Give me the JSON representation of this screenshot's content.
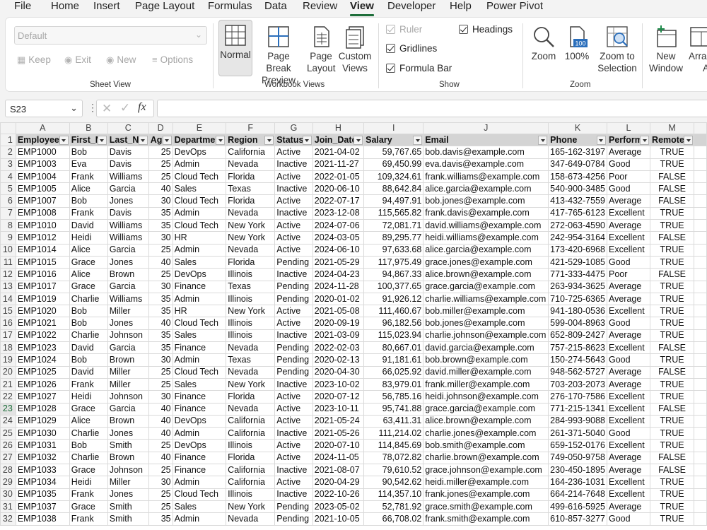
{
  "menu": {
    "tabs": [
      {
        "id": "file",
        "label": "File"
      },
      {
        "id": "home",
        "label": "Home"
      },
      {
        "id": "insert",
        "label": "Insert"
      },
      {
        "id": "page-layout",
        "label": "Page Layout"
      },
      {
        "id": "formulas",
        "label": "Formulas"
      },
      {
        "id": "data",
        "label": "Data"
      },
      {
        "id": "review",
        "label": "Review"
      },
      {
        "id": "view",
        "label": "View"
      },
      {
        "id": "developer",
        "label": "Developer"
      },
      {
        "id": "help",
        "label": "Help"
      },
      {
        "id": "power-pivot",
        "label": "Power Pivot"
      }
    ],
    "active": "View"
  },
  "ribbon": {
    "sheet_view": {
      "label": "Sheet View",
      "select_value": "Default",
      "keep": "Keep",
      "exit": "Exit",
      "new": "New",
      "options": "Options"
    },
    "workbook_views": {
      "label": "Workbook Views",
      "normal": "Normal",
      "page_break_preview_1": "Page Break",
      "page_break_preview_2": "Preview",
      "page_layout_1": "Page",
      "page_layout_2": "Layout",
      "custom_views_1": "Custom",
      "custom_views_2": "Views"
    },
    "show": {
      "label": "Show",
      "ruler": "Ruler",
      "gridlines": "Gridlines",
      "formula_bar": "Formula Bar",
      "headings": "Headings"
    },
    "zoom": {
      "label": "Zoom",
      "zoom": "Zoom",
      "hundred": "100%",
      "hundred_icon": "100",
      "zoom_sel_1": "Zoom to",
      "zoom_sel_2": "Selection"
    },
    "window": {
      "new_window_1": "New",
      "new_window_2": "Window",
      "arrange_1": "Arran",
      "arrange_2": "Al"
    }
  },
  "formula_bar": {
    "name_box": "S23",
    "fx": "fx",
    "formula": ""
  },
  "grid": {
    "columns": [
      "A",
      "B",
      "C",
      "D",
      "E",
      "F",
      "G",
      "H",
      "I",
      "J",
      "K",
      "L",
      "M"
    ],
    "header_row": [
      "Employee",
      "First_N",
      "Last_N",
      "Ag",
      "Departme",
      "Region",
      "Status",
      "Join_Date",
      "Salary",
      "Email",
      "Phone",
      "Perform",
      "Remote"
    ],
    "selected_row": 23,
    "rows": [
      [
        "EMP1000",
        "Bob",
        "Davis",
        "25",
        "DevOps",
        "California",
        "Active",
        "2021-04-02",
        "59,767.65",
        "bob.davis@example.com",
        "165-162-3197",
        "Average",
        "TRUE"
      ],
      [
        "EMP1003",
        "Eva",
        "Davis",
        "25",
        "Admin",
        "Nevada",
        "Inactive",
        "2021-11-27",
        "69,450.99",
        "eva.davis@example.com",
        "347-649-0784",
        "Good",
        "TRUE"
      ],
      [
        "EMP1004",
        "Frank",
        "Williams",
        "25",
        "Cloud Tech",
        "Florida",
        "Active",
        "2022-01-05",
        "109,324.61",
        "frank.williams@example.com",
        "158-673-4256",
        "Poor",
        "FALSE"
      ],
      [
        "EMP1005",
        "Alice",
        "Garcia",
        "40",
        "Sales",
        "Texas",
        "Inactive",
        "2020-06-10",
        "88,642.84",
        "alice.garcia@example.com",
        "540-900-3485",
        "Good",
        "FALSE"
      ],
      [
        "EMP1007",
        "Bob",
        "Jones",
        "30",
        "Cloud Tech",
        "Florida",
        "Active",
        "2022-07-17",
        "94,497.91",
        "bob.jones@example.com",
        "413-432-7559",
        "Average",
        "FALSE"
      ],
      [
        "EMP1008",
        "Frank",
        "Davis",
        "35",
        "Admin",
        "Nevada",
        "Inactive",
        "2023-12-08",
        "115,565.82",
        "frank.davis@example.com",
        "417-765-6123",
        "Excellent",
        "TRUE"
      ],
      [
        "EMP1010",
        "David",
        "Williams",
        "35",
        "Cloud Tech",
        "New York",
        "Active",
        "2024-07-06",
        "72,081.71",
        "david.williams@example.com",
        "272-063-4590",
        "Average",
        "TRUE"
      ],
      [
        "EMP1012",
        "Heidi",
        "Williams",
        "30",
        "HR",
        "New York",
        "Active",
        "2024-03-05",
        "89,295.77",
        "heidi.williams@example.com",
        "242-954-3164",
        "Excellent",
        "FALSE"
      ],
      [
        "EMP1014",
        "Alice",
        "Garcia",
        "25",
        "Admin",
        "Nevada",
        "Active",
        "2024-06-10",
        "97,633.68",
        "alice.garcia@example.com",
        "173-420-6968",
        "Excellent",
        "TRUE"
      ],
      [
        "EMP1015",
        "Grace",
        "Jones",
        "40",
        "Sales",
        "Florida",
        "Pending",
        "2021-05-29",
        "117,975.49",
        "grace.jones@example.com",
        "421-529-1085",
        "Good",
        "TRUE"
      ],
      [
        "EMP1016",
        "Alice",
        "Brown",
        "25",
        "DevOps",
        "Illinois",
        "Inactive",
        "2024-04-23",
        "94,867.33",
        "alice.brown@example.com",
        "771-333-4475",
        "Poor",
        "FALSE"
      ],
      [
        "EMP1017",
        "Grace",
        "Garcia",
        "30",
        "Finance",
        "Texas",
        "Pending",
        "2024-11-28",
        "100,377.65",
        "grace.garcia@example.com",
        "263-934-3625",
        "Average",
        "TRUE"
      ],
      [
        "EMP1019",
        "Charlie",
        "Williams",
        "35",
        "Admin",
        "Illinois",
        "Pending",
        "2020-01-02",
        "91,926.12",
        "charlie.williams@example.com",
        "710-725-6365",
        "Average",
        "TRUE"
      ],
      [
        "EMP1020",
        "Bob",
        "Miller",
        "35",
        "HR",
        "New York",
        "Active",
        "2021-05-08",
        "111,460.67",
        "bob.miller@example.com",
        "941-180-0536",
        "Excellent",
        "TRUE"
      ],
      [
        "EMP1021",
        "Bob",
        "Jones",
        "40",
        "Cloud Tech",
        "Illinois",
        "Active",
        "2020-09-19",
        "96,182.56",
        "bob.jones@example.com",
        "599-004-8963",
        "Good",
        "TRUE"
      ],
      [
        "EMP1022",
        "Charlie",
        "Johnson",
        "35",
        "Sales",
        "Illinois",
        "Inactive",
        "2021-03-09",
        "115,023.94",
        "charlie.johnson@example.com",
        "652-809-2427",
        "Average",
        "TRUE"
      ],
      [
        "EMP1023",
        "David",
        "Garcia",
        "35",
        "Finance",
        "Nevada",
        "Pending",
        "2022-02-03",
        "80,667.01",
        "david.garcia@example.com",
        "757-215-8623",
        "Excellent",
        "FALSE"
      ],
      [
        "EMP1024",
        "Bob",
        "Brown",
        "30",
        "Admin",
        "Texas",
        "Pending",
        "2020-02-13",
        "91,181.61",
        "bob.brown@example.com",
        "150-274-5643",
        "Good",
        "TRUE"
      ],
      [
        "EMP1025",
        "David",
        "Miller",
        "25",
        "Cloud Tech",
        "Nevada",
        "Pending",
        "2020-04-30",
        "66,025.92",
        "david.miller@example.com",
        "948-562-5727",
        "Average",
        "FALSE"
      ],
      [
        "EMP1026",
        "Frank",
        "Miller",
        "25",
        "Sales",
        "New York",
        "Inactive",
        "2023-10-02",
        "83,979.01",
        "frank.miller@example.com",
        "703-203-2073",
        "Average",
        "TRUE"
      ],
      [
        "EMP1027",
        "Heidi",
        "Johnson",
        "30",
        "Finance",
        "Florida",
        "Active",
        "2020-07-12",
        "56,785.16",
        "heidi.johnson@example.com",
        "276-170-7586",
        "Excellent",
        "TRUE"
      ],
      [
        "EMP1028",
        "Grace",
        "Garcia",
        "40",
        "Finance",
        "Nevada",
        "Active",
        "2023-10-11",
        "95,741.88",
        "grace.garcia@example.com",
        "771-215-1341",
        "Excellent",
        "FALSE"
      ],
      [
        "EMP1029",
        "Alice",
        "Brown",
        "40",
        "DevOps",
        "California",
        "Active",
        "2021-05-24",
        "63,411.31",
        "alice.brown@example.com",
        "284-993-9088",
        "Excellent",
        "TRUE"
      ],
      [
        "EMP1030",
        "Charlie",
        "Jones",
        "40",
        "Admin",
        "California",
        "Inactive",
        "2021-05-26",
        "111,214.02",
        "charlie.jones@example.com",
        "261-371-5040",
        "Good",
        "TRUE"
      ],
      [
        "EMP1031",
        "Bob",
        "Smith",
        "25",
        "DevOps",
        "Illinois",
        "Active",
        "2020-07-10",
        "114,845.69",
        "bob.smith@example.com",
        "659-152-0176",
        "Excellent",
        "TRUE"
      ],
      [
        "EMP1032",
        "Charlie",
        "Brown",
        "40",
        "Finance",
        "Florida",
        "Active",
        "2024-11-05",
        "78,072.82",
        "charlie.brown@example.com",
        "749-050-9758",
        "Average",
        "FALSE"
      ],
      [
        "EMP1033",
        "Grace",
        "Johnson",
        "25",
        "Finance",
        "California",
        "Inactive",
        "2021-08-07",
        "79,610.52",
        "grace.johnson@example.com",
        "230-450-1895",
        "Average",
        "FALSE"
      ],
      [
        "EMP1034",
        "Heidi",
        "Miller",
        "30",
        "Admin",
        "California",
        "Active",
        "2020-04-29",
        "90,542.62",
        "heidi.miller@example.com",
        "164-236-1031",
        "Excellent",
        "TRUE"
      ],
      [
        "EMP1035",
        "Frank",
        "Jones",
        "25",
        "Cloud Tech",
        "Illinois",
        "Inactive",
        "2022-10-26",
        "114,357.10",
        "frank.jones@example.com",
        "664-214-7648",
        "Excellent",
        "TRUE"
      ],
      [
        "EMP1037",
        "Grace",
        "Smith",
        "25",
        "Sales",
        "New York",
        "Pending",
        "2023-05-02",
        "52,781.92",
        "grace.smith@example.com",
        "499-616-5925",
        "Average",
        "TRUE"
      ],
      [
        "EMP1038",
        "Frank",
        "Smith",
        "35",
        "Admin",
        "Nevada",
        "Pending",
        "2021-10-05",
        "66,708.02",
        "frank.smith@example.com",
        "610-857-3277",
        "Good",
        "TRUE"
      ]
    ]
  }
}
